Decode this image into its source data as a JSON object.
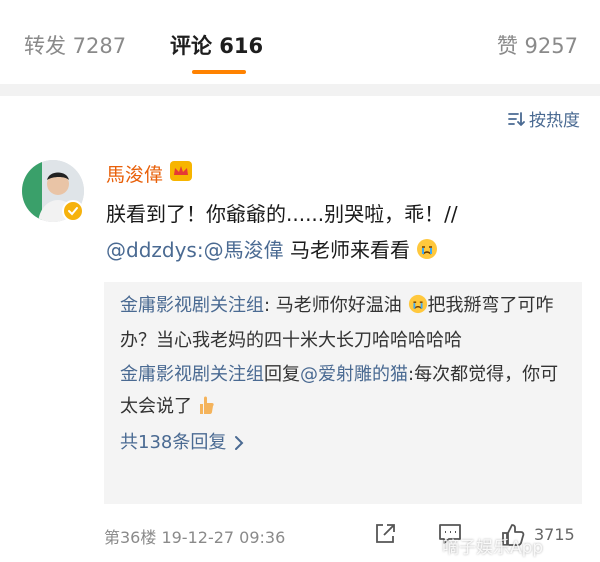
{
  "tabs": {
    "repost": "转发 7287",
    "comments": "评论 616",
    "likes": "赞 9257"
  },
  "sort": {
    "label": "按热度",
    "icon": "sort-icon"
  },
  "comment": {
    "author": "馬浚偉",
    "text_main": "朕看到了！你爺爺的......别哭啦，乖！//",
    "mention_1": "@ddzdys",
    "mention_2": ":@馬浚偉",
    "text_tail": " 马老师来看看",
    "floor_time": "第36楼  19-12-27 09:36",
    "like_count": "3715"
  },
  "replies": [
    {
      "author": "金庸影视剧关注组",
      "text_a": ": 马老师你好温油",
      "text_b": "把我掰弯了可咋办？当心我老妈的四十米大长刀哈哈哈哈哈"
    },
    {
      "author": "金庸影视剧关注组",
      "reply_word": "回复",
      "target": "@爱射雕的猫",
      "text": ":每次都觉得，你可太会说了"
    }
  ],
  "more_replies": "共138条回复",
  "watermark": "嘀子娱乐App",
  "colors": {
    "accent": "#ff8200",
    "link": "#4a6a92",
    "username": "#e8600a",
    "reply_bg": "#f4f4f4"
  }
}
